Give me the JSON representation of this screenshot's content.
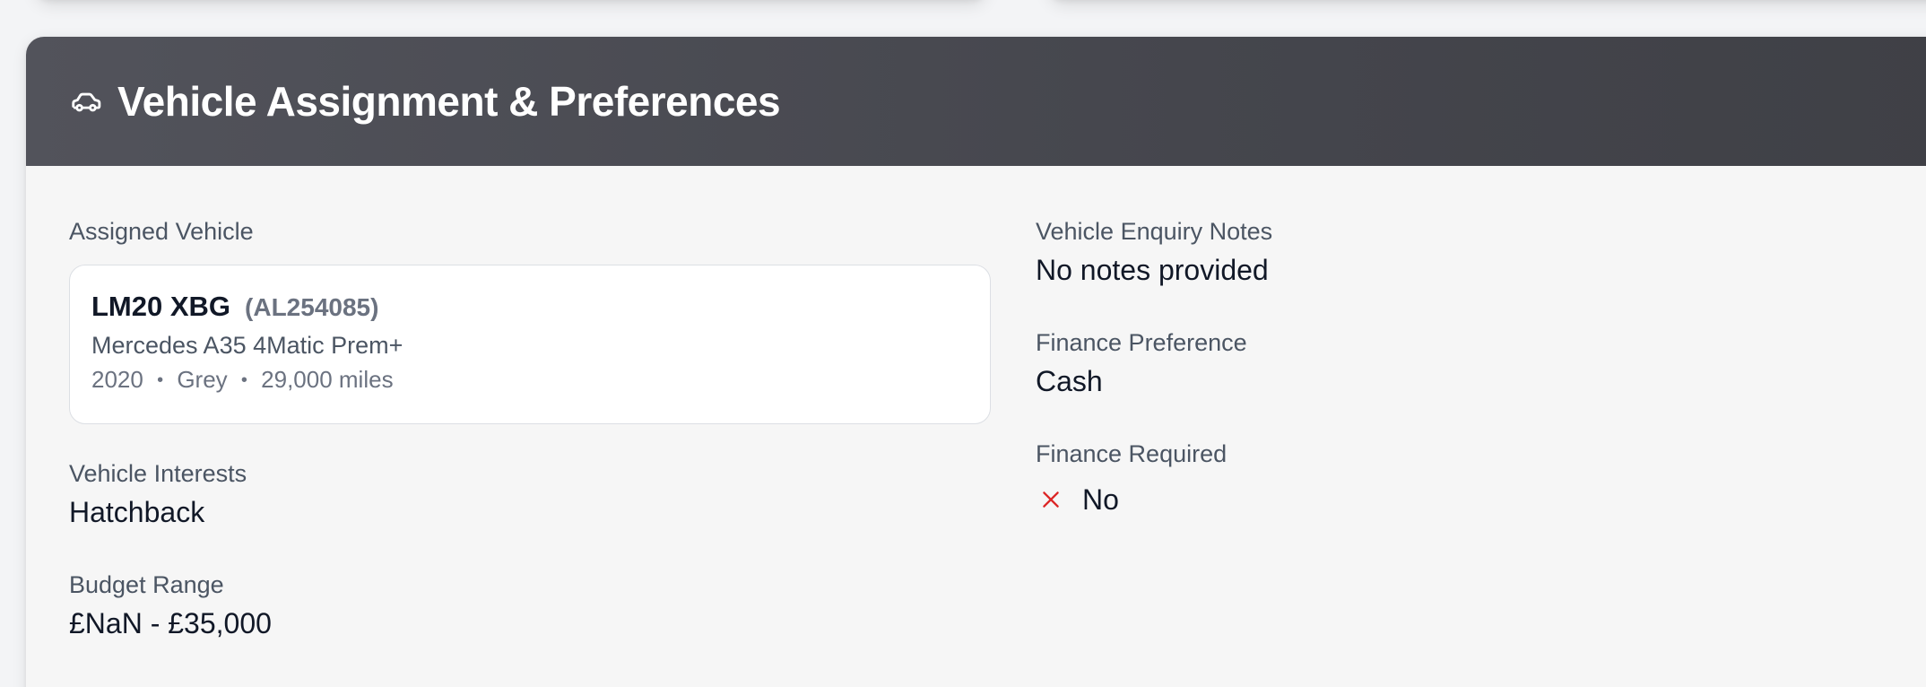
{
  "header": {
    "title": "Vehicle Assignment & Preferences",
    "icon": "car-icon"
  },
  "assigned_vehicle": {
    "label": "Assigned Vehicle",
    "registration": "LM20 XBG",
    "stock_number": "(AL254085)",
    "model": "Mercedes A35 4Matic Prem+",
    "year": "2020",
    "colour": "Grey",
    "mileage": "29,000 miles",
    "separator": "•"
  },
  "vehicle_interests": {
    "label": "Vehicle Interests",
    "value": "Hatchback"
  },
  "budget_range": {
    "label": "Budget Range",
    "value": "£NaN - £35,000"
  },
  "vehicle_enquiry_notes": {
    "label": "Vehicle Enquiry Notes",
    "value": "No notes provided"
  },
  "finance_preference": {
    "label": "Finance Preference",
    "value": "Cash"
  },
  "finance_required": {
    "label": "Finance Required",
    "value": "No",
    "icon": "x-icon",
    "icon_color": "#dc2626"
  },
  "colors": {
    "header_bg": "#4a4b52",
    "panel_bg": "#f6f6f6",
    "card_bg": "#ffffff"
  }
}
